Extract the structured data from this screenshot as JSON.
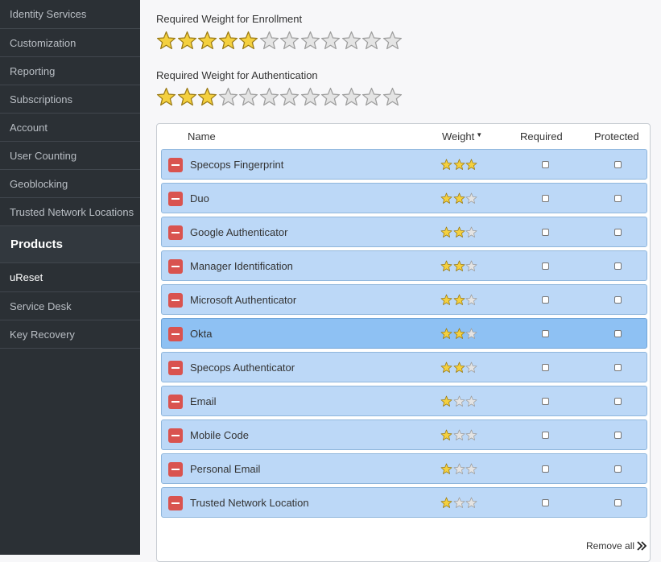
{
  "sidebar": {
    "items_top": [
      {
        "label": "Identity Services"
      },
      {
        "label": "Customization"
      },
      {
        "label": "Reporting"
      },
      {
        "label": "Subscriptions"
      },
      {
        "label": "Account"
      },
      {
        "label": "User Counting"
      },
      {
        "label": "Geoblocking"
      },
      {
        "label": "Trusted Network Locations"
      }
    ],
    "heading": "Products",
    "items_bottom": [
      {
        "label": "uReset",
        "active": true
      },
      {
        "label": "Service Desk"
      },
      {
        "label": "Key Recovery"
      }
    ]
  },
  "enrollment": {
    "label": "Required Weight for Enrollment",
    "rating": 5,
    "max": 12
  },
  "authentication": {
    "label": "Required Weight for Authentication",
    "rating": 3,
    "max": 12
  },
  "table": {
    "headers": {
      "name": "Name",
      "weight": "Weight",
      "required": "Required",
      "protected": "Protected"
    },
    "rows": [
      {
        "name": "Specops Fingerprint",
        "weight": 3
      },
      {
        "name": "Duo",
        "weight": 2
      },
      {
        "name": "Google Authenticator",
        "weight": 2
      },
      {
        "name": "Manager Identification",
        "weight": 2
      },
      {
        "name": "Microsoft Authenticator",
        "weight": 2
      },
      {
        "name": "Okta",
        "weight": 2
      },
      {
        "name": "Specops Authenticator",
        "weight": 2
      },
      {
        "name": "Email",
        "weight": 1
      },
      {
        "name": "Mobile Code",
        "weight": 1
      },
      {
        "name": "Personal Email",
        "weight": 1
      },
      {
        "name": "Trusted Network Location",
        "weight": 1
      }
    ],
    "highlighted_row": "Okta",
    "max_weight": 3
  },
  "remove_all_label": "Remove all",
  "colors": {
    "star_filled": "#f4d03f",
    "star_empty": "#e4e4e4",
    "remove": "#d9534f"
  }
}
